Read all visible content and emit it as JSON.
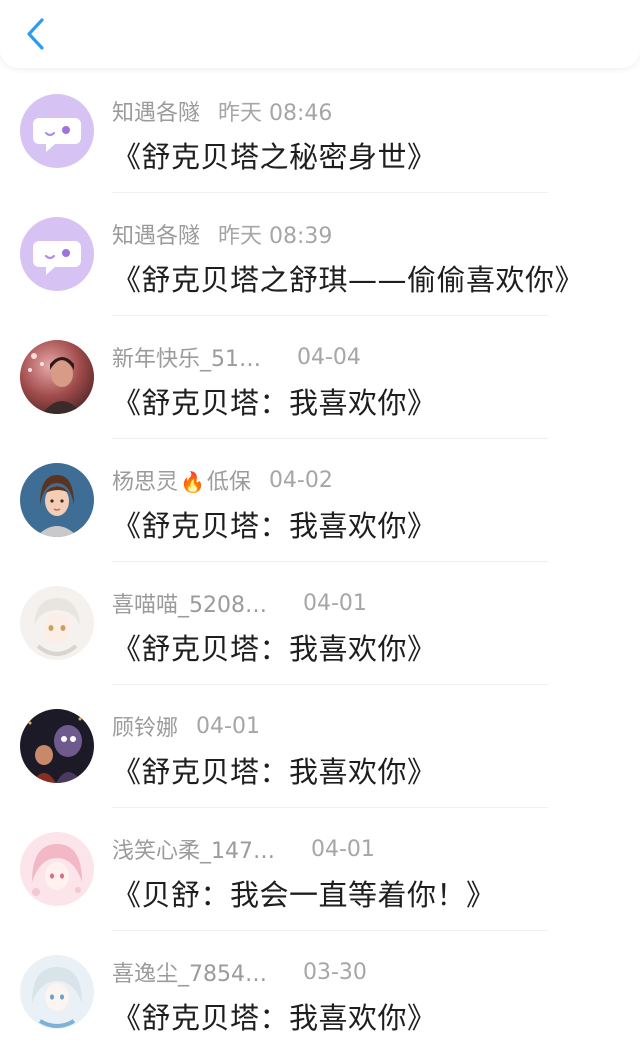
{
  "header": {
    "back_icon": "chevron-left-icon",
    "accent": "#2b9cf0"
  },
  "messages": [
    {
      "name": "知遇各隧",
      "time": "昨天 08:46",
      "title": "《舒克贝塔之秘密身世》",
      "avatar": "chat-bubble-avatar"
    },
    {
      "name": "知遇各隧",
      "time": "昨天 08:39",
      "title": "《舒克贝塔之舒琪——偷偷喜欢你》",
      "avatar": "chat-bubble-avatar"
    },
    {
      "name": "新年快乐_51…",
      "time": "04-04",
      "title": "《舒克贝塔：我喜欢你》",
      "avatar": "photo-avatar"
    },
    {
      "name_a": "杨思灵",
      "name_b": "低保",
      "time": "04-02",
      "title": "《舒克贝塔：我喜欢你》",
      "avatar": "cartoon-girl-avatar"
    },
    {
      "name": "喜喵喵_5208…",
      "time": "04-01",
      "title": "《舒克贝塔：我喜欢你》",
      "avatar": "anime-avatar"
    },
    {
      "name": "顾铃娜",
      "time": "04-01",
      "title": "《舒克贝塔：我喜欢你》",
      "avatar": "night-scene-avatar"
    },
    {
      "name": "浅笑心柔_147…",
      "time": "04-01",
      "title": "《贝舒：我会一直等着你！》",
      "avatar": "pink-anime-avatar"
    },
    {
      "name": "喜逸尘_7854…",
      "time": "03-30",
      "title": "《舒克贝塔：我喜欢你》",
      "avatar": "silver-anime-avatar"
    }
  ]
}
